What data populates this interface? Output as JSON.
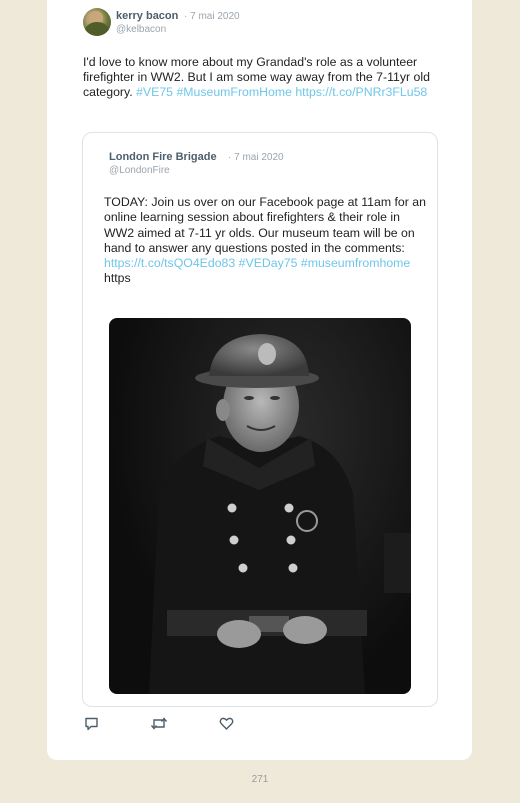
{
  "tweet": {
    "author_name": "kerry bacon",
    "date": "· 7 mai 2020",
    "handle": "@kelbacon",
    "text_plain": "I'd love to know more about my Grandad's role as a volunteer firefighter in WW2. But I am some way away from the 7-11yr old category.",
    "hashtag1": "#VE75",
    "hashtag2": "#MuseumFromHome",
    "link": "https://t.co/PNRr3FLu58"
  },
  "quoted": {
    "author_name": "London Fire Brigade",
    "date": "· 7 mai 2020",
    "handle": "@LondonFire",
    "text_plain": "TODAY: Join us over on our Facebook page at 11am for an online learning session about firefighters & their role in WW2 aimed at 7-11 yr olds. Our museum team will be on hand to answer any questions posted in the comments:",
    "link": "https://t.co/tsQO4Edo83",
    "hashtag1": "#VEDay75",
    "hashtag2": "#museumfromhome",
    "trailing": "https"
  },
  "actions": {
    "reply_icon": "reply-icon",
    "retweet_icon": "retweet-icon",
    "like_icon": "heart-icon"
  },
  "page_number": "271",
  "colors": {
    "background": "#efe9d9",
    "card": "#ffffff",
    "link": "#6ec6ea",
    "name": "#4d5f6b",
    "muted": "#9aa5ad"
  }
}
